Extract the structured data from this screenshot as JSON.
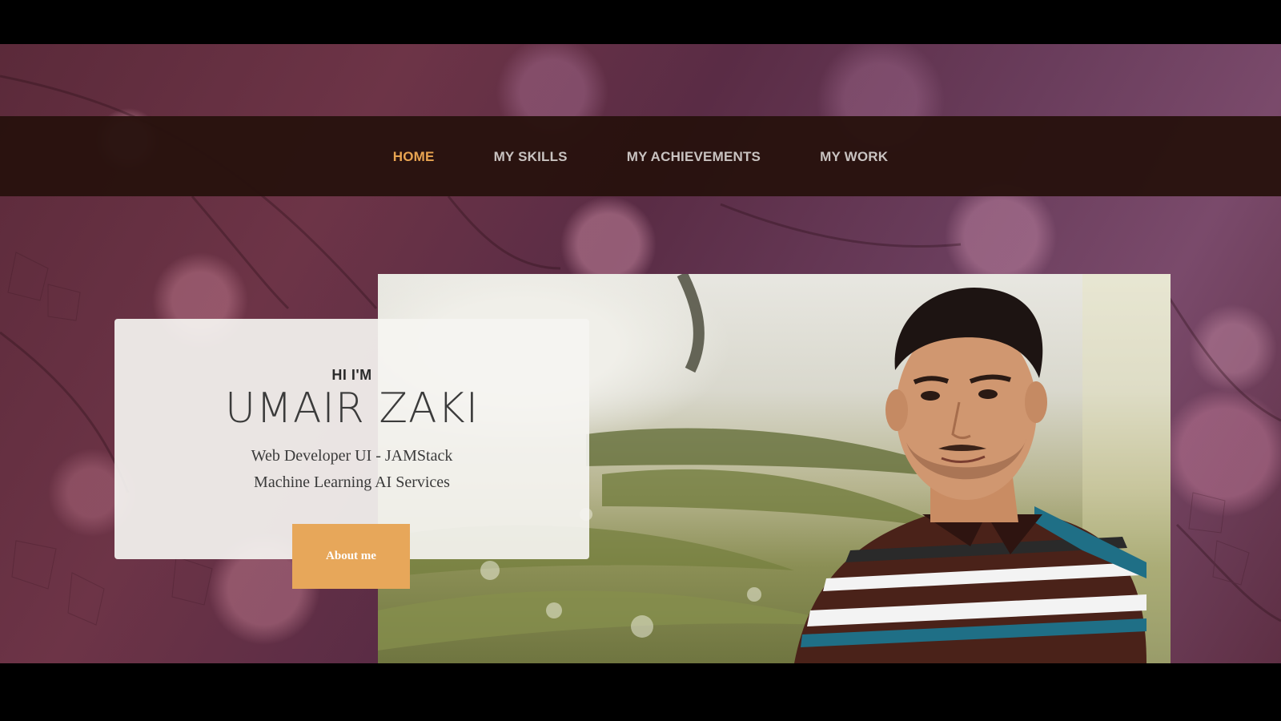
{
  "nav": {
    "items": [
      {
        "label": "HOME",
        "active": true
      },
      {
        "label": "MY SKILLS",
        "active": false
      },
      {
        "label": "MY ACHIEVEMENTS",
        "active": false
      },
      {
        "label": "MY WORK",
        "active": false
      }
    ],
    "active_color": "#e8a451",
    "text_color": "#c9c3c1",
    "bar_color": "#28120e"
  },
  "intro": {
    "greeting": "HI I'M",
    "name": "UMAIR ZAKI",
    "line1": "Web Developer UI - JAMStack",
    "line2": "Machine Learning AI Services"
  },
  "cta": {
    "label": "About me",
    "color": "#e7a75a"
  }
}
